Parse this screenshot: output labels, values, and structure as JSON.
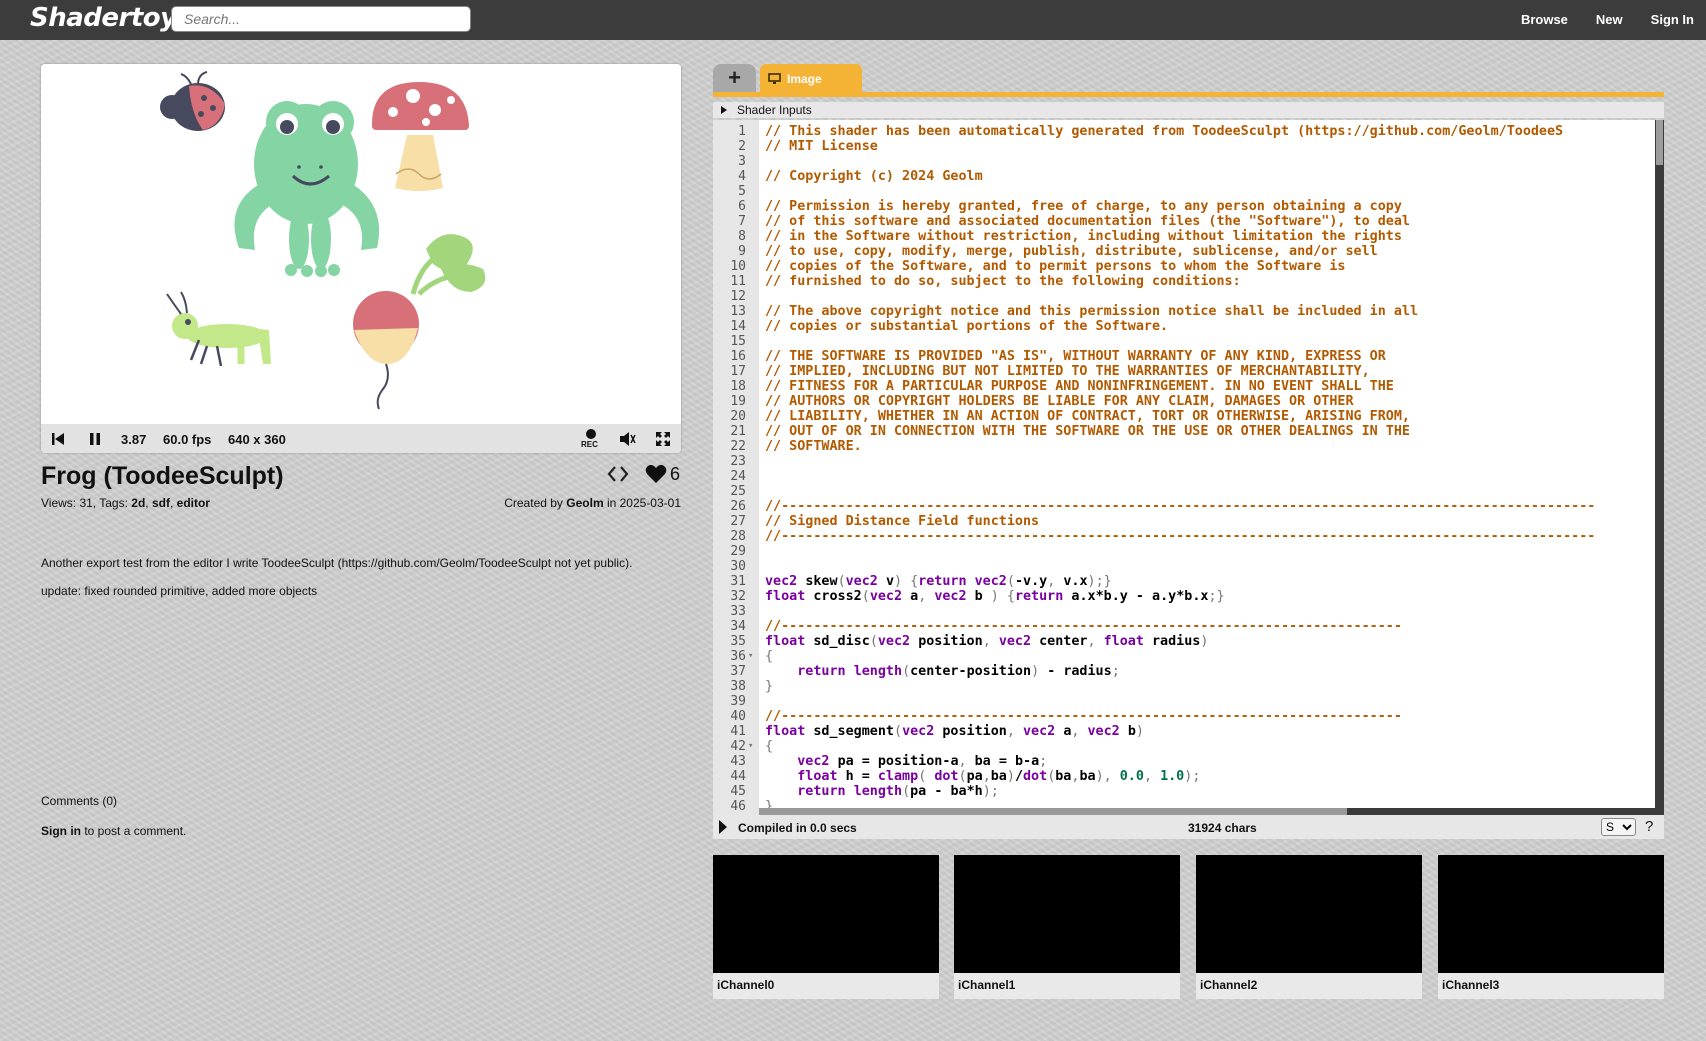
{
  "header": {
    "logo": "Shadertoy",
    "search_placeholder": "Search...",
    "nav": [
      "Browse",
      "New",
      "Sign In"
    ]
  },
  "player": {
    "time": "3.87",
    "fps": "60.0 fps",
    "resolution": "640 x 360",
    "rec_label": "REC"
  },
  "shader": {
    "title": "Frog (ToodeeSculpt)",
    "likes": "6",
    "views_label": "Views: 31, Tags: ",
    "tags": [
      "2d",
      "sdf",
      "editor"
    ],
    "created_prefix": "Created by ",
    "author": "Geolm",
    "created_in": " in 2025-03-01",
    "description": [
      "Another export test from the editor I write ToodeeSculpt (https://github.com/Geolm/ToodeeSculpt not yet public).",
      "update: fixed rounded primitive, added more objects"
    ],
    "comments": "Comments (0)",
    "sign_in": "Sign in",
    "sign_in_suffix": " to post a comment."
  },
  "editor": {
    "tab_add": "+",
    "tab_image": "Image",
    "shader_inputs": "Shader Inputs",
    "compiled": "Compiled in 0.0 secs",
    "chars": "31924 chars",
    "font_size_option": "S",
    "help": "?",
    "code_lines": [
      "// This shader has been automatically generated from ToodeeSculpt (https://github.com/Geolm/ToodeeS",
      "// MIT License",
      "",
      "// Copyright (c) 2024 Geolm",
      "",
      "// Permission is hereby granted, free of charge, to any person obtaining a copy",
      "// of this software and associated documentation files (the \"Software\"), to deal",
      "// in the Software without restriction, including without limitation the rights",
      "// to use, copy, modify, merge, publish, distribute, sublicense, and/or sell",
      "// copies of the Software, and to permit persons to whom the Software is",
      "// furnished to do so, subject to the following conditions:",
      "",
      "// The above copyright notice and this permission notice shall be included in all",
      "// copies or substantial portions of the Software.",
      "",
      "// THE SOFTWARE IS PROVIDED \"AS IS\", WITHOUT WARRANTY OF ANY KIND, EXPRESS OR",
      "// IMPLIED, INCLUDING BUT NOT LIMITED TO THE WARRANTIES OF MERCHANTABILITY,",
      "// FITNESS FOR A PARTICULAR PURPOSE AND NONINFRINGEMENT. IN NO EVENT SHALL THE",
      "// AUTHORS OR COPYRIGHT HOLDERS BE LIABLE FOR ANY CLAIM, DAMAGES OR OTHER",
      "// LIABILITY, WHETHER IN AN ACTION OF CONTRACT, TORT OR OTHERWISE, ARISING FROM,",
      "// OUT OF OR IN CONNECTION WITH THE SOFTWARE OR THE USE OR OTHER DEALINGS IN THE",
      "// SOFTWARE.",
      "",
      "",
      "",
      "//-----------------------------------------------------------------------------------------------------",
      "// Signed Distance Field functions",
      "//-----------------------------------------------------------------------------------------------------",
      "",
      "",
      "vec2 skew(vec2 v) {return vec2(-v.y, v.x);}",
      "float cross2(vec2 a, vec2 b ) {return a.x*b.y - a.y*b.x;}",
      "",
      "//-----------------------------------------------------------------------------",
      "float sd_disc(vec2 position, vec2 center, float radius)",
      "{",
      "    return length(center-position) - radius;",
      "}",
      "",
      "//-----------------------------------------------------------------------------",
      "float sd_segment(vec2 position, vec2 a, vec2 b)",
      "{",
      "    vec2 pa = position-a, ba = b-a;",
      "    float h = clamp( dot(pa,ba)/dot(ba,ba), 0.0, 1.0);",
      "    return length(pa - ba*h);",
      "}"
    ],
    "fold_lines": [
      36,
      42
    ]
  },
  "channels": [
    "iChannel0",
    "iChannel1",
    "iChannel2",
    "iChannel3"
  ],
  "colors": {
    "accent_tab": "#f5b335",
    "header_bg": "#3c3c3c",
    "comment": "#b35a00",
    "keyword": "#7a00a0",
    "number": "#00704a"
  }
}
